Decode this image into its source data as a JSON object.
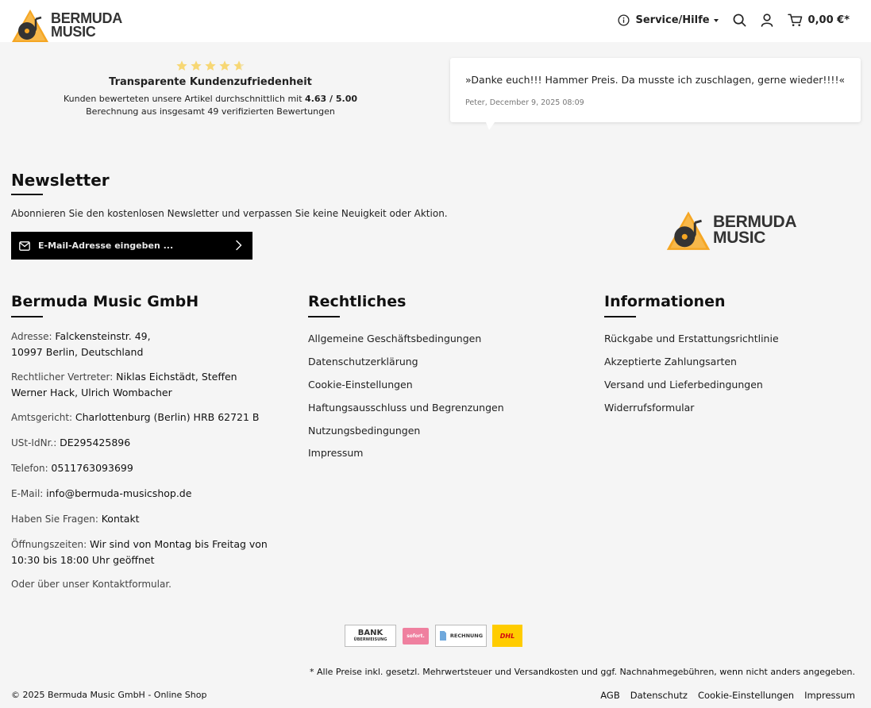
{
  "brand": {
    "line1": "BERMUDA",
    "line2": "MUSIC",
    "accent": "#f5a623"
  },
  "header": {
    "service_label": "Service/Hilfe",
    "cart_total": "0,00 €*"
  },
  "rating": {
    "stars": 5,
    "title": "Transparente Kundenzufriedenheit",
    "text_prefix": "Kunden bewerteten unsere Artikel durchschnittlich mit ",
    "score": "4.63 / 5.00",
    "subtext": "Berechnung aus insgesamt 49 verifizierten Bewertungen"
  },
  "review": {
    "quote": "»Danke euch!!! Hammer Preis. Da musste ich zuschlagen, gerne wieder!!!!«",
    "meta": "Peter, December 9, 2025 08:09"
  },
  "newsletter": {
    "title": "Newsletter",
    "text": "Abonnieren Sie den kostenlosen Newsletter und verpassen Sie keine Neuigkeit oder Aktion.",
    "placeholder": "E-Mail-Adresse eingeben ..."
  },
  "company": {
    "title": "Bermuda Music GmbH",
    "address_label": "Adresse: ",
    "address_line1": "Falckensteinstr. 49,",
    "address_line2": "10997 Berlin, Deutschland",
    "rep_label": "Rechtlicher Vertreter: ",
    "rep_value1": "Niklas Eichstädt, Steffen",
    "rep_value2": "Werner Hack, Ulrich Wombacher",
    "court_label": "Amtsgericht: ",
    "court_value": "Charlottenburg (Berlin) HRB 62721 B",
    "vat_label": "USt-IdNr.: ",
    "vat_value": "DE295425896",
    "phone_label": "Telefon: ",
    "phone_value": "0511763093699",
    "email_label": "E-Mail: ",
    "email_value": "info@bermuda-musicshop.de",
    "questions_label": "Haben Sie Fragen: ",
    "questions_value": "Kontakt",
    "hours_label": "Öffnungszeiten: ",
    "hours_value1": "Wir sind von Montag bis Freitag von",
    "hours_value2": "10:30 bis 18:00 Uhr geöffnet",
    "contact_form": "Oder über unser Kontaktformular."
  },
  "legal": {
    "title": "Rechtliches",
    "links": [
      "Allgemeine Geschäftsbedingungen",
      "Datenschutzerklärung",
      "Cookie-Einstellungen",
      "Haftungsausschluss und Begrenzungen",
      "Nutzungsbedingungen",
      "Impressum"
    ]
  },
  "informationen": {
    "title": "Informationen",
    "links": [
      "Rückgabe und Erstattungsrichtlinie",
      "Akzeptierte Zahlungsarten",
      "Versand und Lieferbedingungen",
      "Widerrufsformular"
    ]
  },
  "payments": {
    "bank_line1": "BANK",
    "bank_line2": "ÜBERWEISUNG",
    "sofort": "sofort.",
    "invoice": "RECHNUNG",
    "dhl": "DHL"
  },
  "footer": {
    "disclaimer": "* Alle Preise inkl. gesetzl. Mehrwertsteuer und Versandkosten und ggf. Nachnahmegebühren, wenn nicht anders angegeben.",
    "copyright": "© 2025 Bermuda Music GmbH - Online Shop",
    "links": [
      "AGB",
      "Datenschutz",
      "Cookie-Einstellungen",
      "Impressum"
    ]
  }
}
